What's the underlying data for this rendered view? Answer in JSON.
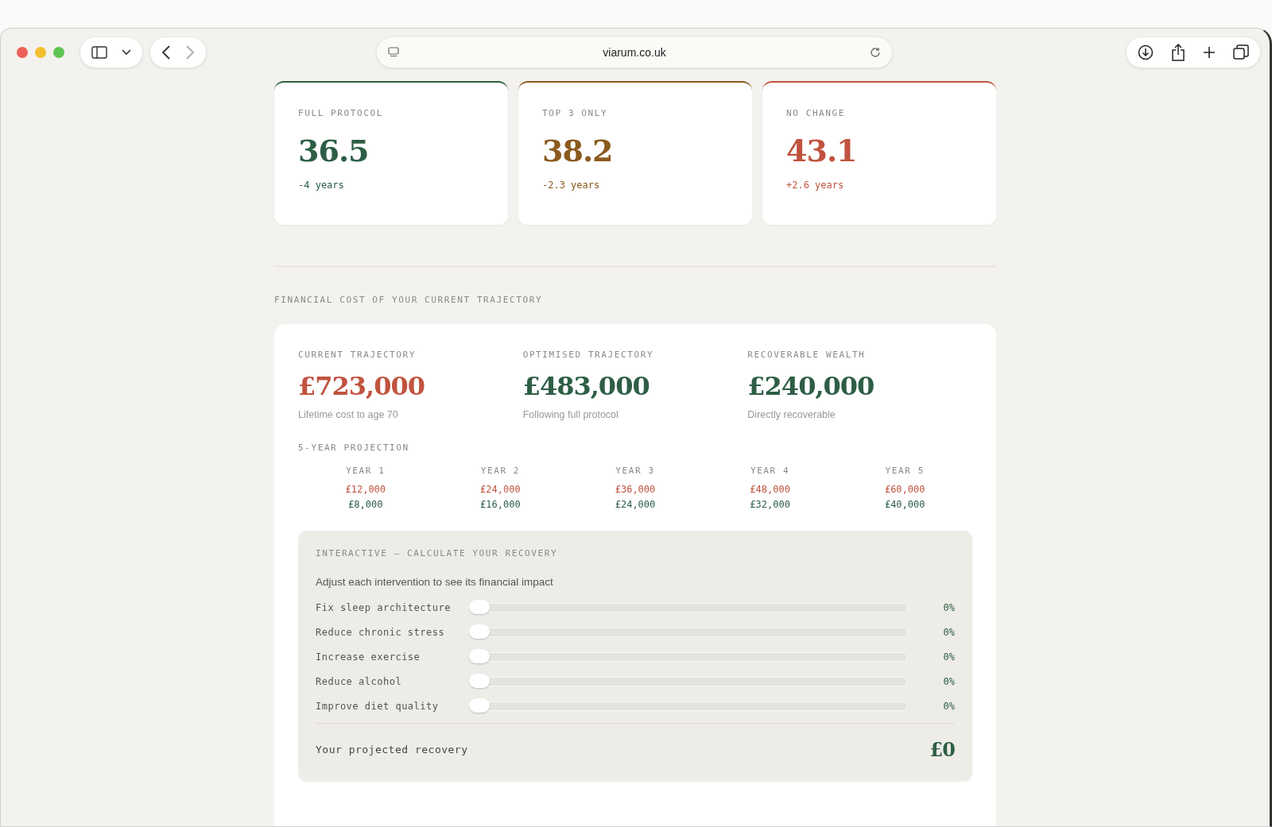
{
  "browser": {
    "url": "viarum.co.uk"
  },
  "age_cards": [
    {
      "label": "FULL PROTOCOL",
      "value": "36.5",
      "delta": "-4 years",
      "color": "#2d5e45"
    },
    {
      "label": "TOP 3 ONLY",
      "value": "38.2",
      "delta": "-2.3 years",
      "color": "#8a5a1e"
    },
    {
      "label": "NO CHANGE",
      "value": "43.1",
      "delta": "+2.6 years",
      "color": "#c0533f"
    }
  ],
  "financial": {
    "heading": "FINANCIAL COST OF YOUR CURRENT TRAJECTORY",
    "metrics": [
      {
        "label": "CURRENT TRAJECTORY",
        "value": "£723,000",
        "caption": "Lifetime cost to age 70",
        "color": "#c0533f"
      },
      {
        "label": "OPTIMISED TRAJECTORY",
        "value": "£483,000",
        "caption": "Following full protocol",
        "color": "#2d5e45"
      },
      {
        "label": "RECOVERABLE WEALTH",
        "value": "£240,000",
        "caption": "Directly recoverable",
        "color": "#2d5e45"
      }
    ],
    "projection": {
      "heading": "5-YEAR PROJECTION",
      "years": [
        {
          "year": "YEAR 1",
          "current": "£12,000",
          "optimised": "£8,000"
        },
        {
          "year": "YEAR 2",
          "current": "£24,000",
          "optimised": "£16,000"
        },
        {
          "year": "YEAR 3",
          "current": "£36,000",
          "optimised": "£24,000"
        },
        {
          "year": "YEAR 4",
          "current": "£48,000",
          "optimised": "£32,000"
        },
        {
          "year": "YEAR 5",
          "current": "£60,000",
          "optimised": "£40,000"
        }
      ]
    },
    "calculator": {
      "heading": "INTERACTIVE — CALCULATE YOUR RECOVERY",
      "intro": "Adjust each intervention to see its financial impact",
      "sliders": [
        {
          "label": "Fix sleep architecture",
          "level": 0,
          "reading": "0%"
        },
        {
          "label": "Reduce chronic stress",
          "level": 0,
          "reading": "0%"
        },
        {
          "label": "Increase exercise",
          "level": 0,
          "reading": "0%"
        },
        {
          "label": "Reduce alcohol",
          "level": 0,
          "reading": "0%"
        },
        {
          "label": "Improve diet quality",
          "level": 0,
          "reading": "0%"
        }
      ],
      "result_label": "Your projected recovery",
      "result_value": "£0"
    }
  }
}
